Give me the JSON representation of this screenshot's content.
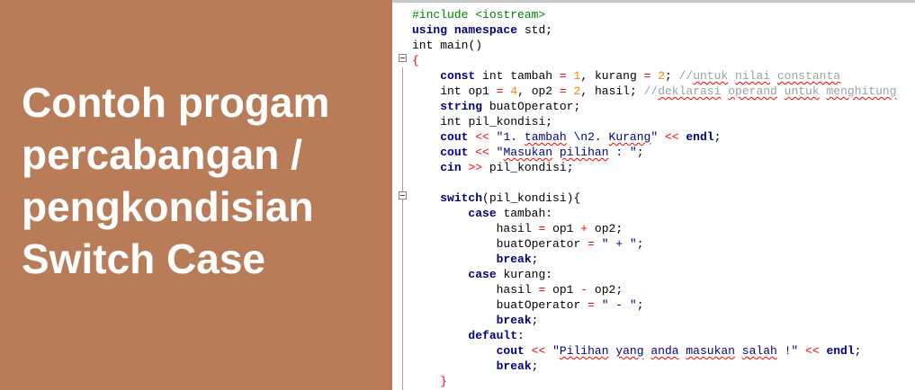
{
  "title": {
    "lines": [
      "Contoh progam",
      "percabangan /",
      "pengkondisian",
      "Switch Case"
    ]
  },
  "colors": {
    "panel_background": "#b97c59",
    "title_text": "#ffffff",
    "preprocessor": "#008000",
    "keyword": "#000080",
    "number": "#ff8000",
    "operator": "#ff0000",
    "comment": "#a0a0a0",
    "spellcheck": "#ff0000"
  },
  "code": {
    "language": "C++",
    "lines": [
      "#include <iostream>",
      "using namespace std;",
      "int main()",
      "{",
      "    const int tambah = 1, kurang = 2; //untuk nilai constanta",
      "    int op1 = 4, op2 = 2, hasil; //deklarasi operand untuk menghitung",
      "    string buatOperator;",
      "    int pil_kondisi;",
      "    cout << \"1. tambah \\n2. Kurang\" << endl;",
      "    cout << \"Masukan pilihan : \";",
      "    cin >> pil_kondisi;",
      "",
      "    switch(pil_kondisi){",
      "        case tambah:",
      "            hasil = op1 + op2;",
      "            buatOperator = \" + \";",
      "            break;",
      "        case kurang:",
      "            hasil = op1 - op2;",
      "            buatOperator = \" - \";",
      "            break;",
      "        default:",
      "            cout << \"Pilihan yang anda masukan salah !\" << endl;",
      "            break;",
      "    }"
    ]
  }
}
